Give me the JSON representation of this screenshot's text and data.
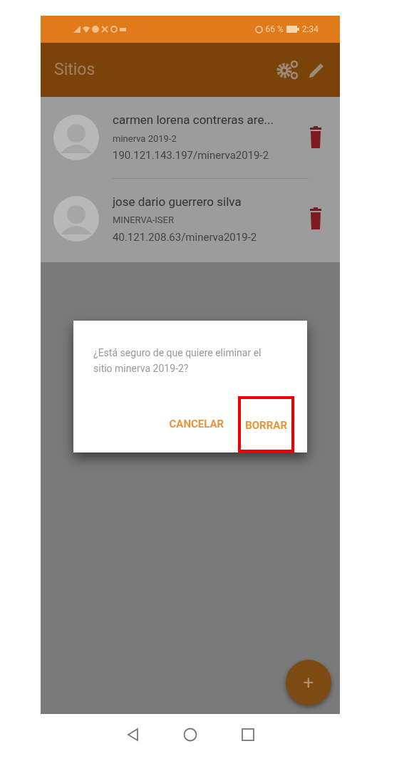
{
  "status_bar": {
    "battery": "66 %",
    "time": "2:34"
  },
  "app_bar": {
    "title": "Sitios"
  },
  "sites": [
    {
      "name": "carmen lorena contreras are...",
      "site": "minerva 2019-2",
      "address": "190.121.143.197/minerva2019-2"
    },
    {
      "name": "jose dario guerrero silva",
      "site": "MINERVA-ISER",
      "address": "40.121.208.63/minerva2019-2"
    }
  ],
  "dialog": {
    "message": "¿Está seguro de que quiere eliminar el sitio minerva 2019-2?",
    "buttons": [
      {
        "label": "CANCELAR",
        "highlighted": false
      },
      {
        "label": "BORRAR",
        "highlighted": true
      }
    ]
  },
  "fab": {
    "label": "+"
  }
}
